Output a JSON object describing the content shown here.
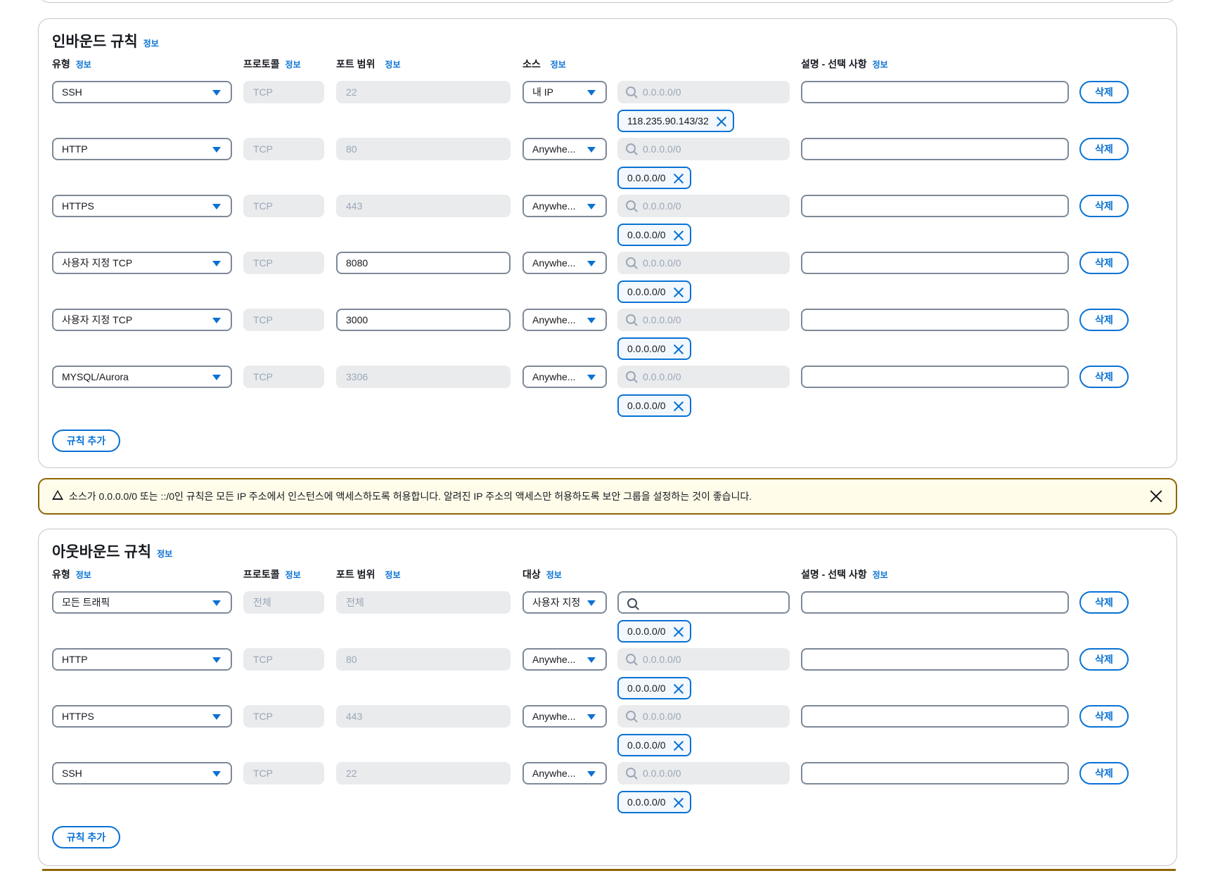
{
  "info_label": "정보",
  "inbound": {
    "title": "인바운드 규칙",
    "headers": {
      "type": "유형",
      "protocol": "프로토콜",
      "port": "포트 범위",
      "source": "소스",
      "description": "설명 - 선택 사항"
    },
    "search_placeholder": "0.0.0.0/0",
    "rules": [
      {
        "type": "SSH",
        "protocol": "TCP",
        "port": "22",
        "port_editable": false,
        "source": "내 IP",
        "token": "118.235.90.143/32",
        "search_enabled": false
      },
      {
        "type": "HTTP",
        "protocol": "TCP",
        "port": "80",
        "port_editable": false,
        "source": "Anywhe...",
        "token": "0.0.0.0/0",
        "search_enabled": false
      },
      {
        "type": "HTTPS",
        "protocol": "TCP",
        "port": "443",
        "port_editable": false,
        "source": "Anywhe...",
        "token": "0.0.0.0/0",
        "search_enabled": false
      },
      {
        "type": "사용자 지정 TCP",
        "protocol": "TCP",
        "port": "8080",
        "port_editable": true,
        "source": "Anywhe...",
        "token": "0.0.0.0/0",
        "search_enabled": false
      },
      {
        "type": "사용자 지정 TCP",
        "protocol": "TCP",
        "port": "3000",
        "port_editable": true,
        "source": "Anywhe...",
        "token": "0.0.0.0/0",
        "search_enabled": false
      },
      {
        "type": "MYSQL/Aurora",
        "protocol": "TCP",
        "port": "3306",
        "port_editable": false,
        "source": "Anywhe...",
        "token": "0.0.0.0/0",
        "search_enabled": false
      }
    ],
    "delete_label": "삭제",
    "add_rule_label": "규칙 추가"
  },
  "warning": {
    "text": "소스가 0.0.0.0/0 또는 ::/0인 규칙은 모든 IP 주소에서 인스턴스에 액세스하도록 허용합니다. 알려진 IP 주소의 액세스만 허용하도록 보안 그룹을 설정하는 것이 좋습니다."
  },
  "outbound": {
    "title": "아웃바운드 규칙",
    "headers": {
      "type": "유형",
      "protocol": "프로토콜",
      "port": "포트 범위",
      "source": "대상",
      "description": "설명 - 선택 사항"
    },
    "search_placeholder": "0.0.0.0/0",
    "rules": [
      {
        "type": "모든 트래픽",
        "protocol": "전체",
        "port": "전체",
        "port_editable": false,
        "source": "사용자 지정",
        "token": "0.0.0.0/0",
        "search_enabled": true
      },
      {
        "type": "HTTP",
        "protocol": "TCP",
        "port": "80",
        "port_editable": false,
        "source": "Anywhe...",
        "token": "0.0.0.0/0",
        "search_enabled": false
      },
      {
        "type": "HTTPS",
        "protocol": "TCP",
        "port": "443",
        "port_editable": false,
        "source": "Anywhe...",
        "token": "0.0.0.0/0",
        "search_enabled": false
      },
      {
        "type": "SSH",
        "protocol": "TCP",
        "port": "22",
        "port_editable": false,
        "source": "Anywhe...",
        "token": "0.0.0.0/0",
        "search_enabled": false
      }
    ],
    "delete_label": "삭제",
    "add_rule_label": "규칙 추가"
  }
}
